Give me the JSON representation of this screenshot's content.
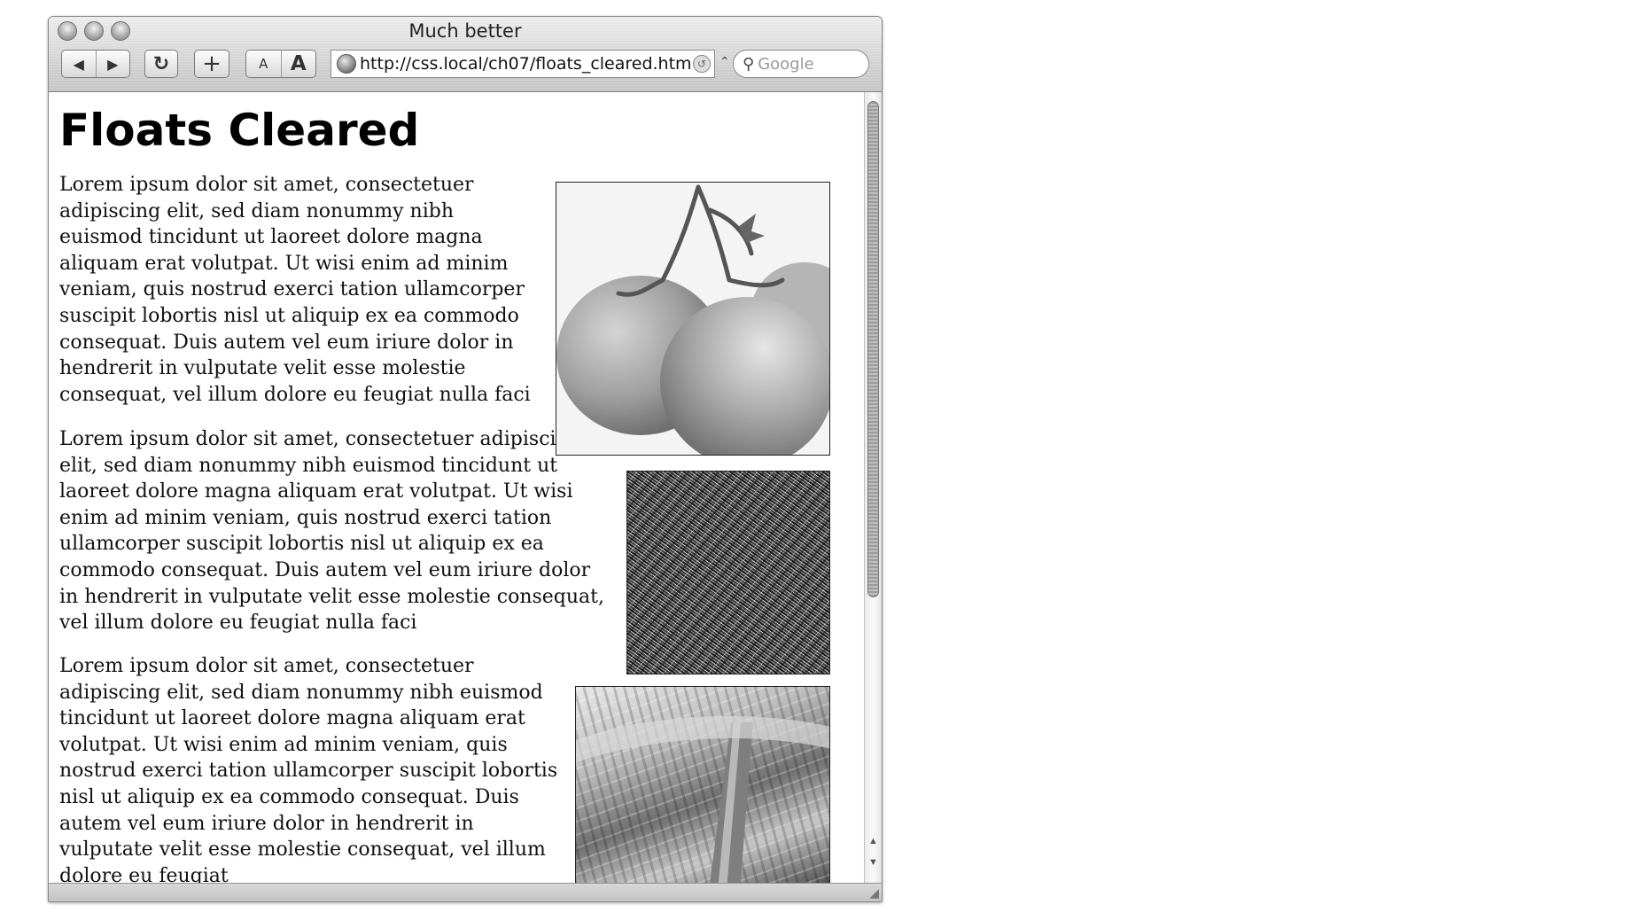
{
  "window": {
    "title": "Much better",
    "url": "http://css.local/ch07/floats_cleared.html",
    "search_placeholder": "Google"
  },
  "toolbar": {
    "back_icon": "◀",
    "forward_icon": "▶",
    "reload_icon": "↻",
    "add_icon": "+",
    "text_smaller": "A",
    "text_larger": "A"
  },
  "page": {
    "heading": "Floats Cleared",
    "paragraphs": [
      "Lorem ipsum dolor sit amet, consectetuer adipiscing elit, sed diam nonummy nibh euismod tincidunt ut laoreet dolore magna aliquam erat volutpat. Ut wisi enim ad minim veniam, quis nostrud exerci tation ullamcorper suscipit lobortis nisl ut aliquip ex ea commodo consequat. Duis autem vel eum iriure dolor in hendrerit in vulputate velit esse molestie consequat, vel illum dolore eu feugiat nulla faci",
      "Lorem ipsum dolor sit amet, consectetuer adipiscing elit, sed diam nonummy nibh euismod tincidunt ut laoreet dolore magna aliquam erat volutpat. Ut wisi enim ad minim veniam, quis nostrud exerci tation ullamcorper suscipit lobortis nisl ut aliquip ex ea commodo consequat. Duis autem vel eum iriure dolor in hendrerit in vulputate velit esse molestie consequat, vel illum dolore eu feugiat nulla faci",
      "Lorem ipsum dolor sit amet, consectetuer adipiscing elit, sed diam nonummy nibh euismod tincidunt ut laoreet dolore magna aliquam erat volutpat. Ut wisi enim ad minim veniam, quis nostrud exerci tation ullamcorper suscipit lobortis nisl ut aliquip ex ea commodo consequat. Duis autem vel eum iriure dolor in hendrerit in vulputate velit esse molestie consequat, vel illum dolore eu feugiat"
    ],
    "images": [
      "tomatoes-photo",
      "grass-photo",
      "plant-stem-photo"
    ]
  }
}
